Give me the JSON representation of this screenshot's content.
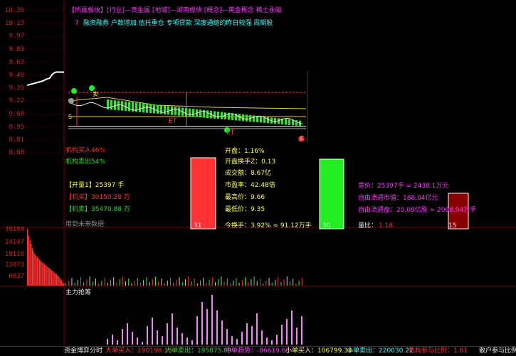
{
  "header": {
    "line1": "【所属板块】[行业]—贵金属 [地域]—湖南板块 [概念]—黄金概念 稀土永磁",
    "line2_num": "7",
    "line2_text": "融资融券 户数增加 信托重仓 专项贷款 深度通缩的昨日较强 周期股"
  },
  "price_axis": [
    "10.30",
    "10.13",
    "9.97",
    "9.80",
    "9.63",
    "9.49",
    "9.35",
    "9.22",
    "9.08",
    "8.95",
    "8.81",
    "8.68"
  ],
  "volume_axis": [
    "30184",
    "24147",
    "18110",
    "12073",
    "6037"
  ],
  "left_stats": {
    "inst_buy": "机构买入46%",
    "inst_sell": "机构卖出54%",
    "open_amount": "【开量1】25397 手",
    "inst_buy_amt": "【机买】30150.28 万",
    "inst_sell_amt": "【机卖】35470.88 万",
    "future_data": "用到未来数据"
  },
  "mid_stats": {
    "open": "开盘：1.16%",
    "open_turnover": "开盘换手Z：0.13",
    "turnover_amt": "成交额：8.67亿",
    "pe": "市盈率：42.48倍",
    "high": "最高价：9.66",
    "low": "最低价：9.35",
    "today_turnover": "今换手：3.92% ≈ 91.12万手"
  },
  "right_stats": {
    "bid": "竞价：25397手 = 2438.1万元",
    "float_cap": "自由流通市值：188.04亿元",
    "float_shares": "自由流通盘：20.09亿股 ≈ 2008.94万手",
    "ratio_label": "量比：",
    "ratio_value": "1.18"
  },
  "bar_labels": {
    "red": "31",
    "green": "30",
    "dark": "15"
  },
  "markers": {
    "e": "E",
    "s": "S",
    "t": "T",
    "sell": "卖",
    "buy": "买",
    "top": "顶"
  },
  "dde_label": "主力抢筹",
  "footer": {
    "label": "资金博弈分时",
    "big_buy": "大单买入：190198.13",
    "big_sell": "大单卖出：195875.09",
    "mid_trend": "中单趋势：-86619.63",
    "small_buy": "小单买入：106799.34",
    "small_sell": "小单卖出：220030.22",
    "inst_ratio": "机构参与比例：1.81",
    "retail_ratio": "散户参与比例："
  },
  "colors": {
    "up": "#ff3333",
    "down": "#22ee22",
    "dark_red": "#880000",
    "pink": "#ee88ee",
    "grid": "#5a0000"
  },
  "chart_data": {
    "type": "line",
    "price_line": [
      9.45,
      9.46,
      9.47,
      9.48,
      9.49,
      9.5,
      9.52,
      9.53,
      9.58,
      9.6,
      9.6,
      9.6
    ],
    "ylim": [
      8.55,
      10.35
    ],
    "volume_bars": [
      30184,
      26500,
      24147,
      22000,
      20000,
      18110,
      17000,
      16000,
      15200,
      14500,
      13800,
      13200,
      12500,
      12073,
      11500,
      10900,
      10200,
      9800,
      9300,
      8800,
      8200,
      7600,
      7000,
      6400,
      6037,
      5500,
      4800,
      3900,
      2900,
      2000,
      1200
    ]
  }
}
